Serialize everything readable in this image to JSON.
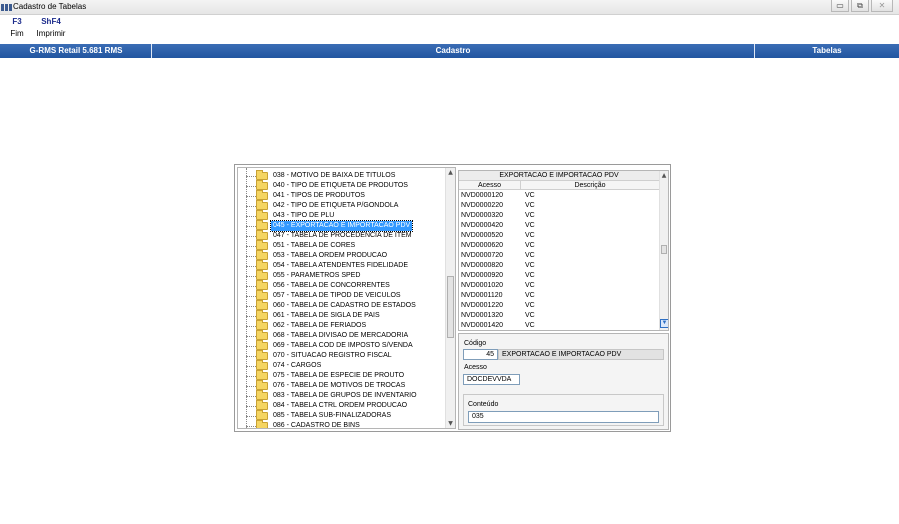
{
  "window": {
    "title": "Cadastro de Tabelas",
    "controls": {
      "minimize": "▭",
      "maximize": "⧉",
      "close": "✕"
    }
  },
  "function_keys": [
    {
      "key": "F3",
      "label": "Fim"
    },
    {
      "key": "ShF4",
      "label": "Imprimir"
    }
  ],
  "header": {
    "app": "G-RMS Retail 5.681 RMS",
    "section": "Cadastro",
    "module": "Tabelas"
  },
  "tree": {
    "items": [
      "038 - MOTIVO DE BAIXA DE TITULOS",
      "040 - TIPO DE ETIQUETA DE PRODUTOS",
      "041 - TIPOS DE PRODUTOS",
      "042 - TIPO DE ETIQUETA P/GONDOLA",
      "043 - TIPO DE PLU",
      "045 - EXPORTACAO E IMPORTACAO PDV",
      "047 - TABELA DE PROCEDENCIA DE ITEM",
      "051 - TABELA DE CORES",
      "053 - TABELA ORDEM PRODUCAO",
      "054 - TABELA ATENDENTES FIDELIDADE",
      "055 - PARAMETROS SPED",
      "056 - TABELA DE CONCORRENTES",
      "057 - TABELA DE TIPOD DE VEICULOS",
      "060 - TABELA DE CADASTRO DE ESTADOS",
      "061 - TABELA DE SIGLA DE PAIS",
      "062 - TABELA DE FERIADOS",
      "068 - TABELA DIVISAO DE MERCADORIA",
      "069 - TABELA COD DE IMPOSTO S/VENDA",
      "070 - SITUACAO REGISTRO FISCAL",
      "074 - CARGOS",
      "075 - TABELA DE ESPECIE DE PROUTO",
      "076 - TABELA DE MOTIVOS DE TROCAS",
      "083 - TABELA DE GRUPOS DE INVENTARIO",
      "084 - TABELA CTRL ORDEM PRODUCAO",
      "085 - TABELA SUB-FINALIZADORAS",
      "086 - CADASTRO DE BINS"
    ],
    "selected_index": 5,
    "scroll_position": 0.55
  },
  "grid": {
    "title": "EXPORTACAO E IMPORTACAO PDV",
    "columns": [
      "Acesso",
      "Descrição"
    ],
    "rows": [
      [
        "NVD0000120",
        "VC"
      ],
      [
        "NVD0000220",
        "VC"
      ],
      [
        "NVD0000320",
        "VC"
      ],
      [
        "NVD0000420",
        "VC"
      ],
      [
        "NVD0000520",
        "VC"
      ],
      [
        "NVD0000620",
        "VC"
      ],
      [
        "NVD0000720",
        "VC"
      ],
      [
        "NVD0000820",
        "VC"
      ],
      [
        "NVD0000920",
        "VC"
      ],
      [
        "NVD0001020",
        "VC"
      ],
      [
        "NVD0001120",
        "VC"
      ],
      [
        "NVD0001220",
        "VC"
      ],
      [
        "NVD0001320",
        "VC"
      ],
      [
        "NVD0001420",
        "VC"
      ]
    ],
    "scroll_position": 0.5
  },
  "form": {
    "codigo_label": "Código",
    "codigo_value": "45",
    "codigo_desc": "EXPORTACAO E IMPORTACAO PDV",
    "acesso_label": "Acesso",
    "acesso_value": "DOCDEVVDA",
    "conteudo_label": "Conteúdo",
    "conteudo_value": "035"
  },
  "scroll_arrows": {
    "up": "▲",
    "down": "▼"
  },
  "colors": {
    "header_blue": "#2155a0",
    "selection": "#3399ff",
    "fkey_text": "#1c2c8c"
  }
}
